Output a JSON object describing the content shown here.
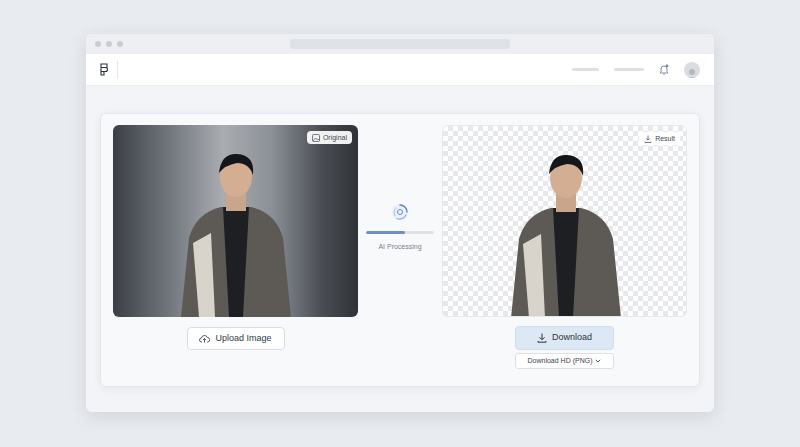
{
  "badges": {
    "original": "Original",
    "result": "Result"
  },
  "upload": {
    "label": "Upload Image"
  },
  "processing": {
    "label": "AI Processing",
    "level": 0.57
  },
  "download": {
    "label": "Download"
  },
  "download_hd": {
    "label": "Download HD (PNG)"
  }
}
